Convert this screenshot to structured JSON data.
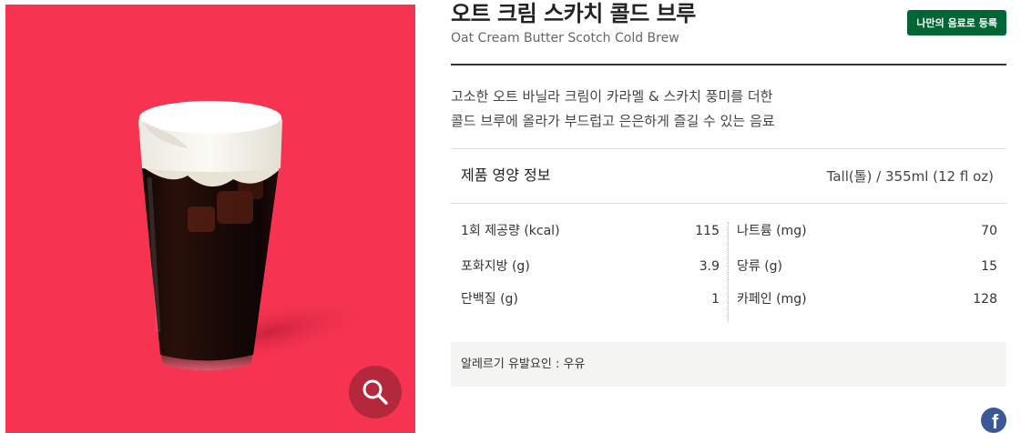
{
  "product": {
    "title_ko": "오트 크림 스카치 콜드 브루",
    "title_en": "Oat Cream Butter Scotch Cold Brew",
    "register_label": "나만의 음료로 등록",
    "description_lines": [
      "고소한 오트 바닐라 크림이 카라멜 & 스카치 풍미를 더한",
      "콜드 브루에 올라가 부드럽고 은은하게 즐길 수 있는 음료"
    ],
    "image_bg_color": "#f63451",
    "zoom_icon": "search-icon"
  },
  "nutrition": {
    "title": "제품 영양 정보",
    "serving": "Tall(톨) / 355ml (12 fl oz)",
    "left": [
      {
        "label": "1회 제공량 (kcal)",
        "value": "115"
      },
      {
        "label": "포화지방 (g)",
        "value": "3.9"
      },
      {
        "label": "단백질 (g)",
        "value": "1"
      }
    ],
    "right": [
      {
        "label": "나트륨 (mg)",
        "value": "70"
      },
      {
        "label": "당류 (g)",
        "value": "15"
      },
      {
        "label": "카페인 (mg)",
        "value": "128"
      }
    ]
  },
  "allergy": {
    "text": "알레르기 유발요인 : 우유"
  },
  "share": {
    "facebook_icon": "facebook-icon",
    "facebook_glyph": "f"
  }
}
